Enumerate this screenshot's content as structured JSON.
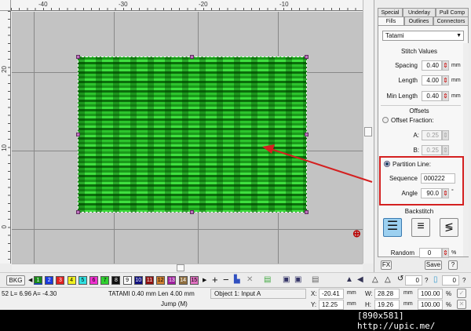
{
  "rulers": {
    "top": [
      "-40",
      "-30",
      "-20",
      "-10"
    ],
    "left": [
      "20",
      "10",
      "0"
    ]
  },
  "panel": {
    "tabs_row1": [
      "Special",
      "Underlay",
      "Pull Comp"
    ],
    "tabs_row2": [
      "Fills",
      "Outlines",
      "Connectors"
    ],
    "active_tab": "Fills",
    "fill_type": "Tatami",
    "stitch_values_title": "Stitch Values",
    "spacing": {
      "label": "Spacing",
      "value": "0.40",
      "unit": "mm"
    },
    "length": {
      "label": "Length",
      "value": "4.00",
      "unit": "mm"
    },
    "min_length": {
      "label": "Min Length",
      "value": "0.40",
      "unit": "mm"
    },
    "offsets_title": "Offsets",
    "offset_fraction": {
      "label": "Offset Fraction:",
      "selected": false
    },
    "a": {
      "label": "A:",
      "value": "0.25"
    },
    "b": {
      "label": "B:",
      "value": "0.25"
    },
    "partition_line": {
      "label": "Partition Line:",
      "selected": true
    },
    "sequence": {
      "label": "Sequence",
      "value": "000222"
    },
    "angle": {
      "label": "Angle",
      "value": "90.0",
      "unit": "°"
    },
    "backstitch_title": "Backstitch",
    "random": {
      "label": "Random",
      "value": "0",
      "unit": "%"
    },
    "fx_label": "FX",
    "save_label": "Save",
    "help_label": "?"
  },
  "highlight_color": "#d42020",
  "toolbar": {
    "bkg_label": "BKG",
    "swatches": [
      {
        "n": "1",
        "c": "#1a8a1a"
      },
      {
        "n": "2",
        "c": "#1a3adf"
      },
      {
        "n": "3",
        "c": "#e02020"
      },
      {
        "n": "4",
        "c": "#f0f020"
      },
      {
        "n": "5",
        "c": "#30e0e0"
      },
      {
        "n": "6",
        "c": "#f030d0"
      },
      {
        "n": "7",
        "c": "#30d030"
      },
      {
        "n": "8",
        "c": "#111111"
      },
      {
        "n": "9",
        "c": "#ffffff"
      },
      {
        "n": "10",
        "c": "#101080"
      },
      {
        "n": "11",
        "c": "#901010"
      },
      {
        "n": "12",
        "c": "#d08030"
      },
      {
        "n": "13",
        "c": "#a020a0"
      },
      {
        "n": "14",
        "c": "#907040"
      },
      {
        "n": "15",
        "c": "#e070c0"
      }
    ],
    "rotate_value": "0",
    "rotate_q": "?",
    "slant_value": "0",
    "slant_q": "?"
  },
  "status": {
    "coords": "52 L=  6.96 A= -4.30",
    "stitch_info": "TATAMI  0.40 mm Len  4.00 mm",
    "jump": "Jump (M)",
    "object": "Object 1: Input A",
    "x_label": "X:",
    "x": "-20.41",
    "y_label": "Y:",
    "y": "12.25",
    "w_label": "W:",
    "w": "28.28",
    "h_label": "H:",
    "h": "19.26",
    "mm": "mm",
    "w_pct": "100.00",
    "h_pct": "100.00",
    "pct": "%"
  },
  "watermark": "[890x581] http://upic.me/"
}
